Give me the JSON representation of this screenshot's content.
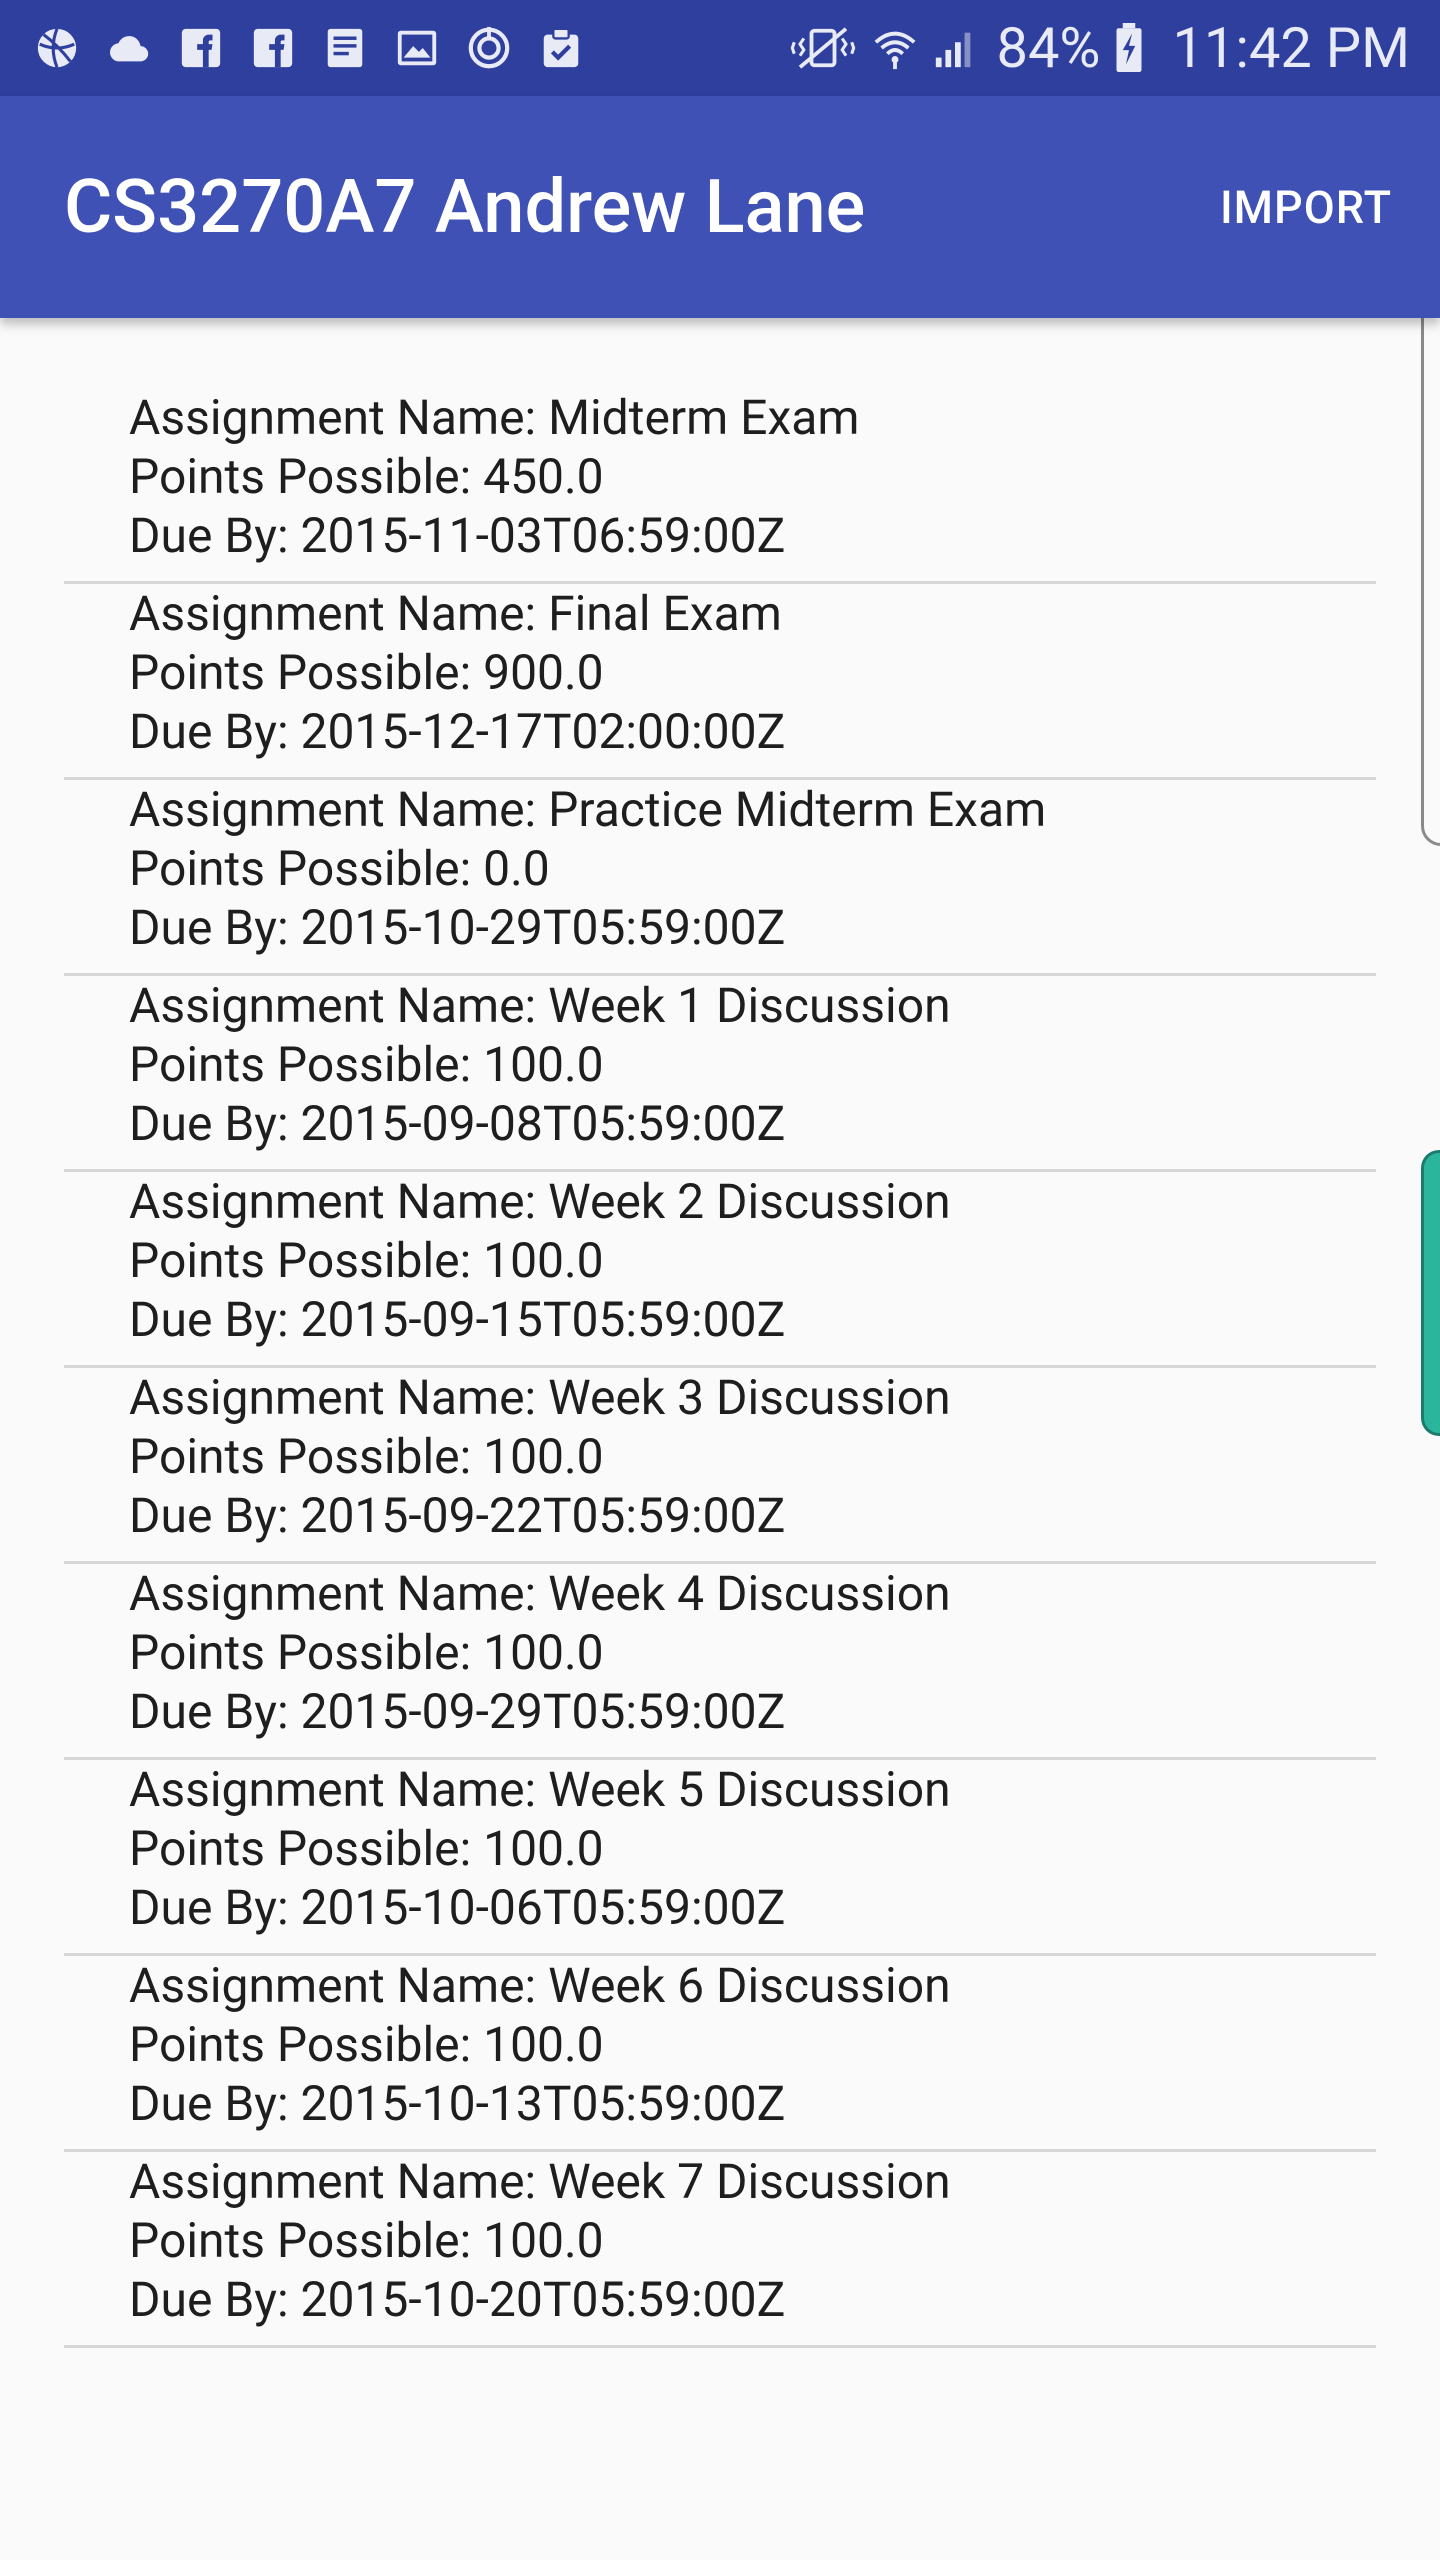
{
  "status_bar": {
    "left_icons": [
      "basketball-icon",
      "cloud-icon",
      "facebook-icon",
      "facebook-icon",
      "document-icon",
      "image-icon",
      "sync-icon",
      "clipboard-check-icon"
    ],
    "right_icons": [
      "vibrate-icon",
      "wifi-icon",
      "signal-icon"
    ],
    "battery_percent": "84%",
    "time": "11:42 PM"
  },
  "app_bar": {
    "title": "CS3270A7 Andrew Lane",
    "import_label": "IMPORT"
  },
  "assignments": [
    {
      "name": "Assignment Name: Midterm Exam",
      "points": "Points Possible: 450.0",
      "due": "Due By: 2015-11-03T06:59:00Z"
    },
    {
      "name": "Assignment Name: Final Exam",
      "points": "Points Possible: 900.0",
      "due": "Due By: 2015-12-17T02:00:00Z"
    },
    {
      "name": "Assignment Name: Practice Midterm Exam",
      "points": "Points Possible: 0.0",
      "due": "Due By: 2015-10-29T05:59:00Z"
    },
    {
      "name": "Assignment Name: Week 1 Discussion",
      "points": "Points Possible: 100.0",
      "due": "Due By: 2015-09-08T05:59:00Z"
    },
    {
      "name": "Assignment Name: Week 2 Discussion",
      "points": "Points Possible: 100.0",
      "due": "Due By: 2015-09-15T05:59:00Z"
    },
    {
      "name": "Assignment Name: Week 3 Discussion",
      "points": "Points Possible: 100.0",
      "due": "Due By: 2015-09-22T05:59:00Z"
    },
    {
      "name": "Assignment Name: Week 4 Discussion",
      "points": "Points Possible: 100.0",
      "due": "Due By: 2015-09-29T05:59:00Z"
    },
    {
      "name": "Assignment Name: Week 5 Discussion",
      "points": "Points Possible: 100.0",
      "due": "Due By: 2015-10-06T05:59:00Z"
    },
    {
      "name": "Assignment Name: Week 6 Discussion",
      "points": "Points Possible: 100.0",
      "due": "Due By: 2015-10-13T05:59:00Z"
    },
    {
      "name": "Assignment Name: Week 7 Discussion",
      "points": "Points Possible: 100.0",
      "due": "Due By: 2015-10-20T05:59:00Z"
    }
  ],
  "colors": {
    "status_bar": "#2f3f9e",
    "app_bar": "#3f51b5",
    "edge_handle": "#2bb59c"
  }
}
